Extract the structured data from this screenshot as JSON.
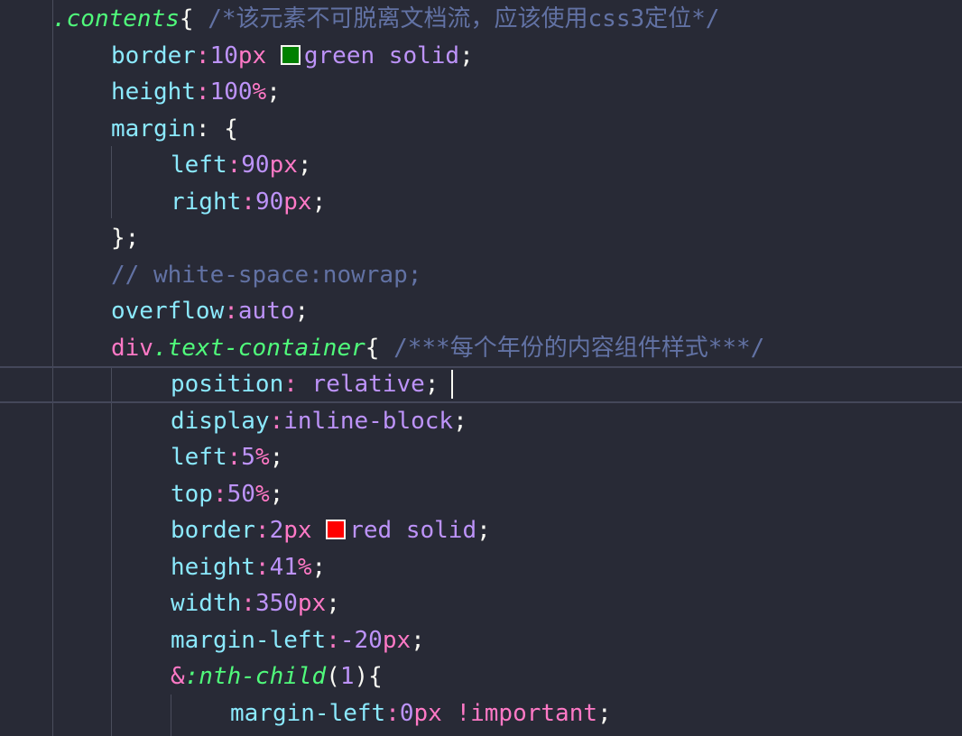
{
  "editor": {
    "lines": [
      {
        "selector": ".contents",
        "brace": "{",
        "comment": "/*该元素不可脱离文档流，应该使用css3定位*/"
      },
      {
        "prop": "border",
        "value_num": "10",
        "value_unit": "px",
        "color_word": "green",
        "style_word": "solid",
        "swatch": "#008000"
      },
      {
        "prop": "height",
        "value_num": "100",
        "value_unit": "%"
      },
      {
        "prop": "margin",
        "brace": "{"
      },
      {
        "prop": "left",
        "value_num": "90",
        "value_unit": "px"
      },
      {
        "prop": "right",
        "value_num": "90",
        "value_unit": "px"
      },
      {
        "text": "};"
      },
      {
        "comment": "// white-space:nowrap;"
      },
      {
        "prop": "overflow",
        "value": "auto"
      },
      {
        "tag": "div",
        "selector": ".text-container",
        "brace": "{",
        "comment": "/***每个年份的内容组件样式***/"
      },
      {
        "prop": "position",
        "value": "relative"
      },
      {
        "prop": "display",
        "value": "inline-block"
      },
      {
        "prop": "left",
        "value_num": "5",
        "value_unit": "%"
      },
      {
        "prop": "top",
        "value_num": "50",
        "value_unit": "%"
      },
      {
        "prop": "border",
        "value_num": "2",
        "value_unit": "px",
        "color_word": "red",
        "style_word": "solid",
        "swatch": "#ff0000"
      },
      {
        "prop": "height",
        "value_num": "41",
        "value_unit": "%"
      },
      {
        "prop": "width",
        "value_num": "350",
        "value_unit": "px"
      },
      {
        "prop": "margin-left",
        "value_num": "-20",
        "value_unit": "px"
      },
      {
        "amp": "&",
        "pseudo": ":nth-child",
        "arg": "1"
      },
      {
        "prop": "margin-left",
        "value_num": "0",
        "value_unit": "px",
        "important": "!important"
      }
    ]
  },
  "colors": {
    "background": "#282a36",
    "selector": "#50fa7b",
    "property": "#8be9fd",
    "keyword": "#ff79c6",
    "number": "#bd93f9",
    "comment": "#6272a4"
  }
}
